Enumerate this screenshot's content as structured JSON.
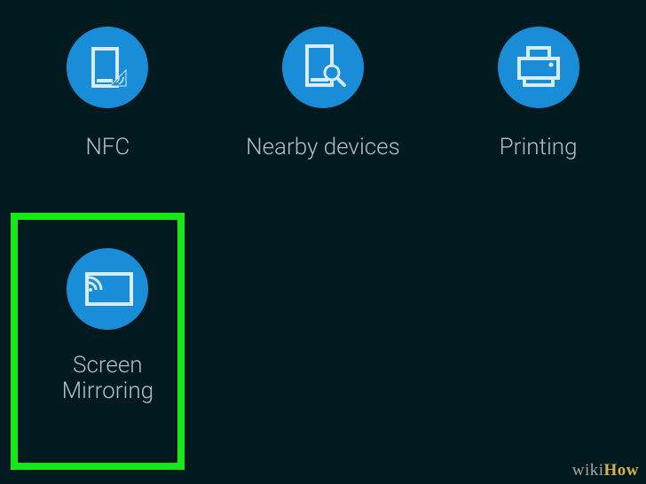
{
  "tiles": {
    "nfc": {
      "label": "NFC"
    },
    "nearby": {
      "label": "Nearby devices"
    },
    "printing": {
      "label": "Printing"
    },
    "mirror": {
      "label": "Screen\nMirroring"
    }
  },
  "watermark": {
    "part1": "wiki",
    "part2": "How"
  },
  "colors": {
    "accent": "#1a8dd8",
    "highlight": "#17e81a"
  }
}
